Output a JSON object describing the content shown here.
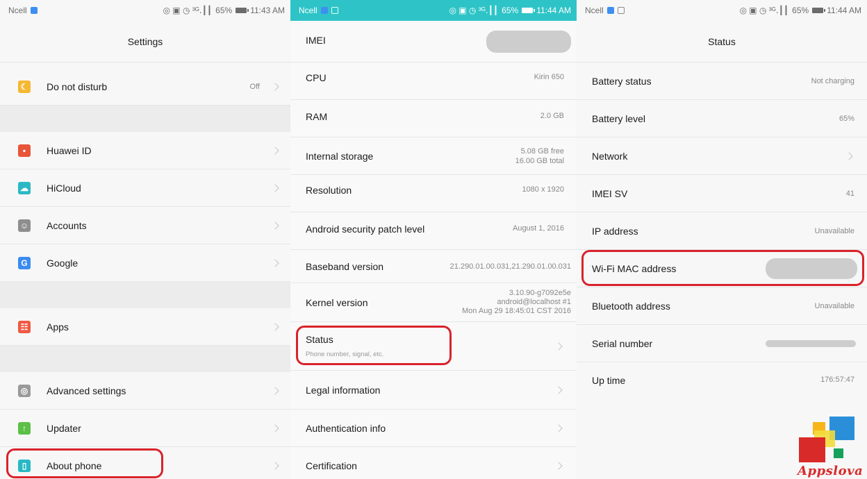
{
  "status_bars": [
    {
      "carrier": "Ncell",
      "indicators": "◎ ▣ ◷ ³ᴳ․┃┃",
      "battery": "65%",
      "time": "11:43 AM"
    },
    {
      "carrier": "Ncell",
      "indicators": "◎ ▣ ◷ ³ᴳ․┃┃",
      "battery": "65%",
      "time": "11:44 AM"
    },
    {
      "carrier": "Ncell",
      "indicators": "◎ ▣ ◷ ³ᴳ․┃┃",
      "battery": "65%",
      "time": "11:44 AM"
    }
  ],
  "settings": {
    "title": "Settings",
    "items": [
      {
        "label": "Do not disturb",
        "value": "Off",
        "icon": "moon-icon",
        "color": "#f6b832",
        "glyph": "☾"
      },
      {
        "label": "Huawei ID",
        "icon": "huawei-id-icon",
        "color": "#e8553a",
        "glyph": "▪"
      },
      {
        "label": "HiCloud",
        "icon": "cloud-icon",
        "color": "#2bb8c4",
        "glyph": "☁"
      },
      {
        "label": "Accounts",
        "icon": "account-icon",
        "color": "#8e8e8e",
        "glyph": "☺"
      },
      {
        "label": "Google",
        "icon": "google-icon",
        "color": "#3b8bf0",
        "glyph": "G"
      },
      {
        "label": "Apps",
        "icon": "apps-icon",
        "color": "#ef5a43",
        "glyph": "☷"
      },
      {
        "label": "Advanced settings",
        "icon": "gear-icon",
        "color": "#9a9a9a",
        "glyph": "◎"
      },
      {
        "label": "Updater",
        "icon": "update-arrow-icon",
        "color": "#5cc046",
        "glyph": "↑"
      },
      {
        "label": "About phone",
        "icon": "phone-info-icon",
        "color": "#27b9c4",
        "glyph": "▯"
      }
    ]
  },
  "about": {
    "items": [
      {
        "label": "IMEI",
        "value": ""
      },
      {
        "label": "CPU",
        "value": "Kirin 650"
      },
      {
        "label": "RAM",
        "value": "2.0 GB"
      },
      {
        "label": "Internal storage",
        "value": "5.08  GB free",
        "value2": "16.00  GB total"
      },
      {
        "label": "Resolution",
        "value": "1080 x 1920"
      },
      {
        "label": "Android security patch level",
        "value": "August 1, 2016"
      },
      {
        "label": "Baseband version",
        "value": "21.290.01.00.031,21.290.01.00.031"
      },
      {
        "label": "Kernel version",
        "value": "3.10.90-g7092e5e",
        "value2": "android@localhost #1",
        "value3": "Mon Aug 29 18:45:01 CST 2016"
      },
      {
        "label": "Status",
        "subtitle": "Phone number, signal, etc."
      },
      {
        "label": "Legal information"
      },
      {
        "label": "Authentication info"
      },
      {
        "label": "Certification"
      }
    ]
  },
  "status": {
    "title": "Status",
    "items": [
      {
        "label": "Battery status",
        "value": "Not charging"
      },
      {
        "label": "Battery level",
        "value": "65%"
      },
      {
        "label": "Network",
        "value": ""
      },
      {
        "label": "IMEI SV",
        "value": "41"
      },
      {
        "label": "IP address",
        "value": "Unavailable"
      },
      {
        "label": "Wi-Fi MAC address",
        "value": ""
      },
      {
        "label": "Bluetooth address",
        "value": "Unavailable"
      },
      {
        "label": "Serial number",
        "value": ""
      },
      {
        "label": "Up time",
        "value": "176:57:47"
      }
    ]
  },
  "watermark": {
    "text": "Appslova",
    "colors": [
      "#f7b51a",
      "#2a8fd8",
      "#d92a2a",
      "#16a05a"
    ]
  },
  "colors": {
    "highlight": "#d9222b",
    "teal_status": "#2ec4c7"
  }
}
